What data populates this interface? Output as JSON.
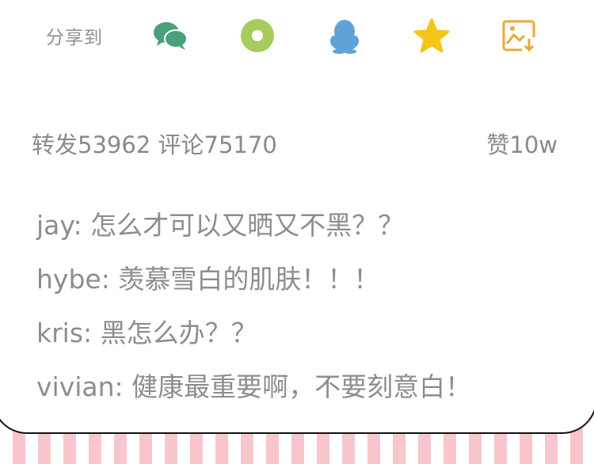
{
  "share": {
    "label": "分享到",
    "icons": [
      {
        "name": "wechat-icon",
        "color": "#4aa07a"
      },
      {
        "name": "moments-icon",
        "color": "#a6cc5e"
      },
      {
        "name": "qq-icon",
        "color": "#5ea3d8"
      },
      {
        "name": "favorite-star-icon",
        "color": "#f5c518"
      },
      {
        "name": "save-image-icon",
        "color": "#e8a93a"
      }
    ]
  },
  "stats": {
    "repost_label": "转发",
    "repost_count": "53962",
    "comment_label": "评论",
    "comment_count": "75170",
    "like_label": "赞",
    "like_count": "10w"
  },
  "comments": [
    {
      "user": "jay",
      "text": "怎么才可以又晒又不黑？？"
    },
    {
      "user": "hybe",
      "text": "羡慕雪白的肌肤！！！"
    },
    {
      "user": "kris",
      "text": "黑怎么办？？"
    },
    {
      "user": "vivian",
      "text": "健康最重要啊，不要刻意白！"
    }
  ],
  "colors": {
    "text_gray": "#8d8d8d",
    "stripe_pink": "#f8c6cc",
    "border": "#111111"
  }
}
